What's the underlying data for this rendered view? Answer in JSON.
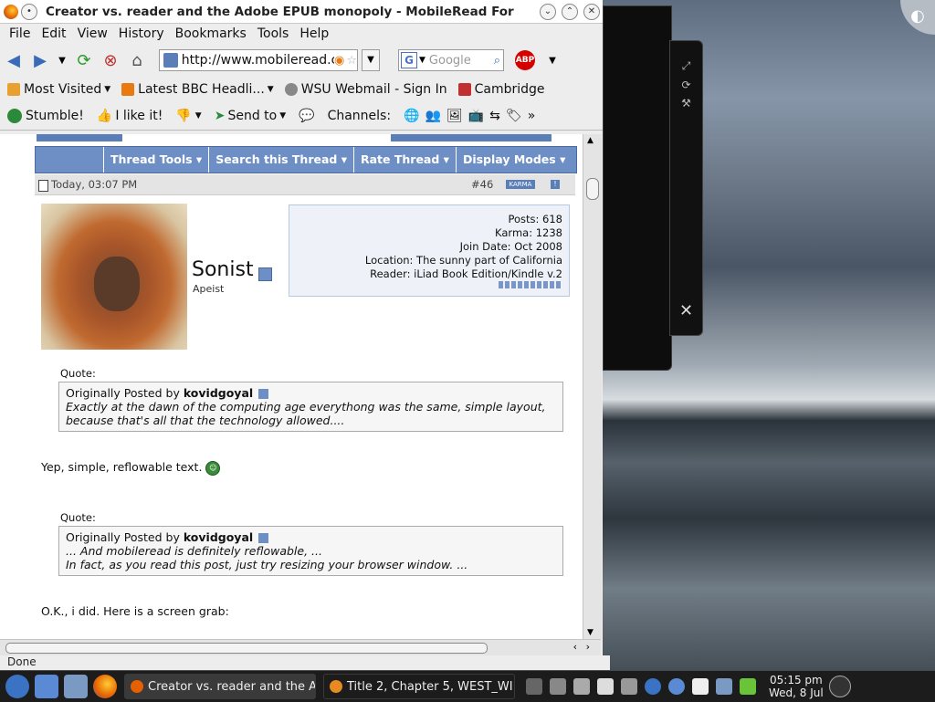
{
  "window": {
    "title": "Creator vs. reader and the Adobe EPUB monopoly - MobileRead For",
    "buttons": {
      "minimize": "⌄",
      "maximize": "⌃",
      "close": "✕"
    }
  },
  "menu": [
    "File",
    "Edit",
    "View",
    "History",
    "Bookmarks",
    "Tools",
    "Help"
  ],
  "nav": {
    "url": "http://www.mobileread.com/",
    "search_placeholder": "Google",
    "abp_label": "ABP"
  },
  "bookmarks": [
    "Most Visited",
    "Latest BBC Headli...",
    "WSU Webmail - Sign In",
    "Cambridge"
  ],
  "stumble": {
    "stumble": "Stumble!",
    "like": "I like it!",
    "send": "Send to",
    "channels": "Channels:"
  },
  "thread_tools": [
    "Thread Tools ▾",
    "Search this Thread ▾",
    "Rate Thread ▾",
    "Display Modes ▾"
  ],
  "post": {
    "date": "Today, 03:07 PM",
    "number": "#46",
    "karma_badge": "KARMA",
    "username": "Sonist",
    "user_title": "Apeist",
    "info": {
      "posts": "Posts: 618",
      "karma": "Karma: 1238",
      "join": "Join Date: Oct 2008",
      "location": "Location: The sunny part of California",
      "reader": "Reader: iLiad Book Edition/Kindle v.2"
    },
    "quote1": {
      "label": "Quote:",
      "by": "Originally Posted by",
      "author": "kovidgoyal",
      "line1": "Exactly at the dawn of the computing age everythong was the same, simple layout,",
      "line2": "because that's all that the technology allowed...."
    },
    "reply1": "Yep, simple, reflowable text.",
    "quote2": {
      "label": "Quote:",
      "by": "Originally Posted by",
      "author": "kovidgoyal",
      "line1": "... And mobileread is definitely reflowable, ...",
      "line2": "In fact, as you read this post, just try resizing your browser window. ..."
    },
    "reply2": "O.K., i did. Here is a screen grab:"
  },
  "status": "Done",
  "taskbar": {
    "tasks": [
      "Creator vs. reader and the A",
      "Title 2, Chapter 5, WEST_WI"
    ],
    "clock_time": "05:15 pm",
    "clock_date": "Wed, 8 Jul"
  },
  "colors": {
    "accent": "#6e8fc6",
    "brand_dark": "#4a69a0"
  }
}
